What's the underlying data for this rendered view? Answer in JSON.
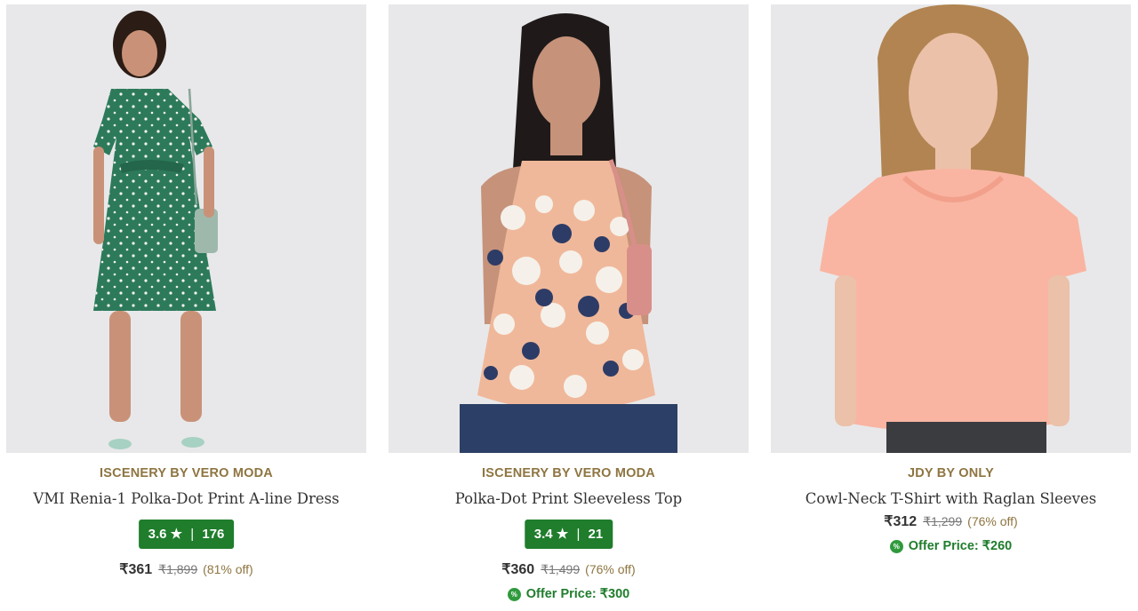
{
  "products": [
    {
      "brand": "ISCENERY BY VERO MODA",
      "name": "VMI Renia-1 Polka-Dot Print A-line Dress",
      "rating": {
        "score": "3.6",
        "star": "★",
        "count": "176"
      },
      "price": "₹361",
      "mrp": "₹1,899",
      "discount": "(81% off)",
      "image_icon": "product-photo-green-polka-dress"
    },
    {
      "brand": "ISCENERY BY VERO MODA",
      "name": "Polka-Dot Print Sleeveless Top",
      "rating": {
        "score": "3.4",
        "star": "★",
        "count": "21"
      },
      "price": "₹360",
      "mrp": "₹1,499",
      "discount": "(76% off)",
      "offer_badge": "%",
      "offer": "Offer Price: ₹300",
      "image_icon": "product-photo-peach-polka-top"
    },
    {
      "brand": "JDY BY ONLY",
      "name": "Cowl-Neck T-Shirt with Raglan Sleeves",
      "price": "₹312",
      "mrp": "₹1,299",
      "discount": "(76% off)",
      "offer_badge": "%",
      "offer": "Offer Price: ₹260",
      "image_icon": "product-photo-peach-tshirt"
    }
  ],
  "colors": {
    "brand": "#8e7541",
    "rating_bg": "#1f7d2c",
    "offer": "#1f7d2c",
    "image_bg": "#e9e9eb"
  }
}
